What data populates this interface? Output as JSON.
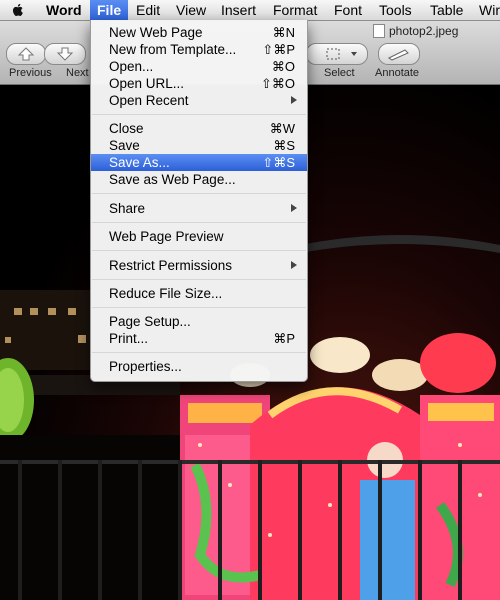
{
  "menubar": {
    "items": [
      {
        "label": "Word"
      },
      {
        "label": "File"
      },
      {
        "label": "Edit"
      },
      {
        "label": "View"
      },
      {
        "label": "Insert"
      },
      {
        "label": "Format"
      },
      {
        "label": "Font"
      },
      {
        "label": "Tools"
      },
      {
        "label": "Table"
      },
      {
        "label": "Wir"
      }
    ]
  },
  "toolbar": {
    "document_title": "photop2.jpeg",
    "labels": {
      "previous": "Previous",
      "next": "Next",
      "select": "Select",
      "annotate": "Annotate"
    }
  },
  "file_menu": {
    "items": [
      {
        "label": "New Web Page",
        "shortcut": "⌘N"
      },
      {
        "label": "New from Template...",
        "shortcut": "⇧⌘P"
      },
      {
        "label": "Open...",
        "shortcut": "⌘O"
      },
      {
        "label": "Open URL...",
        "shortcut": "⇧⌘O"
      },
      {
        "label": "Open Recent",
        "shortcut": ""
      },
      {
        "label": "Close",
        "shortcut": "⌘W"
      },
      {
        "label": "Save",
        "shortcut": "⌘S"
      },
      {
        "label": "Save As...",
        "shortcut": "⇧⌘S"
      },
      {
        "label": "Save as Web Page...",
        "shortcut": ""
      },
      {
        "label": "Share",
        "shortcut": ""
      },
      {
        "label": "Web Page Preview",
        "shortcut": ""
      },
      {
        "label": "Restrict Permissions",
        "shortcut": ""
      },
      {
        "label": "Reduce File Size...",
        "shortcut": ""
      },
      {
        "label": "Page Setup...",
        "shortcut": ""
      },
      {
        "label": "Print...",
        "shortcut": "⌘P"
      },
      {
        "label": "Properties...",
        "shortcut": ""
      }
    ]
  },
  "colors": {
    "highlight": "#3a6ee0",
    "menubar": "#e6e6e6"
  }
}
